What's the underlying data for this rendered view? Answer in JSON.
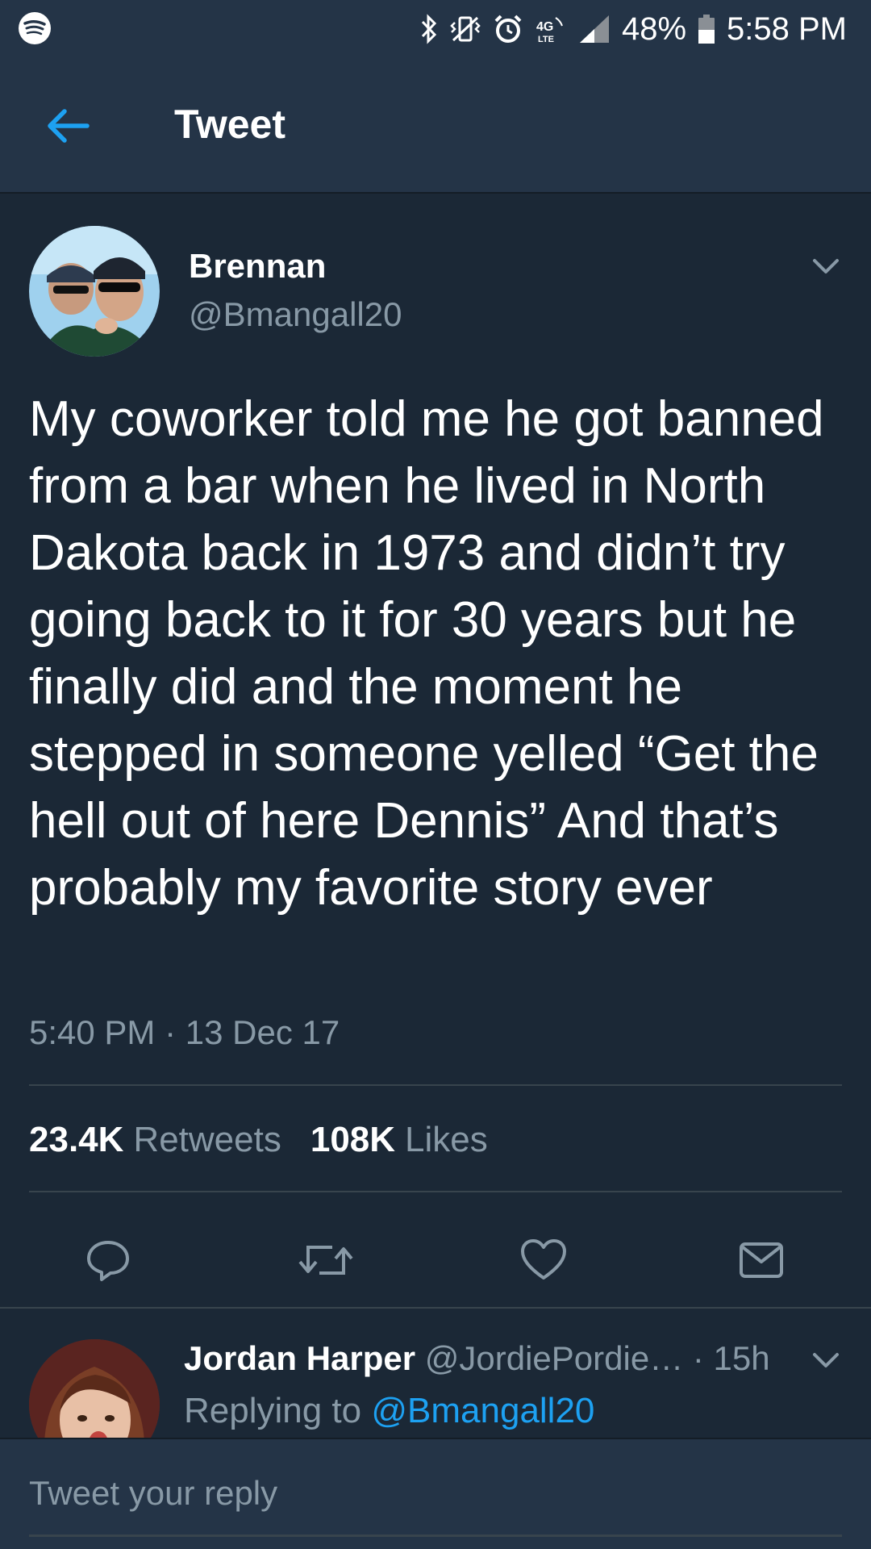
{
  "status_bar": {
    "battery": "48%",
    "time": "5:58 PM",
    "icons": [
      "spotify-icon",
      "bluetooth-icon",
      "vibrate-icon",
      "alarm-icon",
      "4g-lte-icon",
      "signal-icon",
      "battery-icon"
    ]
  },
  "header": {
    "title": "Tweet",
    "back_icon": "arrow-left-icon"
  },
  "tweet": {
    "author_name": "Brennan",
    "author_handle": "@Bmangall20",
    "text": "My coworker told me he got banned from a bar when he lived in North Dakota back in 1973 and didn’t try going back to it for 30 years but he finally did and the moment he stepped in someone yelled “Get the hell out of here Dennis” And that’s probably my favorite story ever",
    "timestamp": "5:40 PM · 13 Dec 17",
    "retweets_count": "23.4K",
    "retweets_label": "Retweets",
    "likes_count": "108K",
    "likes_label": "Likes",
    "actions": [
      "reply-icon",
      "retweet-icon",
      "like-icon",
      "message-icon"
    ]
  },
  "reply": {
    "name": "Jordan Harper",
    "handle": "@JordiePordie…",
    "time": " · 15h",
    "replying_prefix": "Replying to ",
    "replying_handle": "@Bmangall20"
  },
  "compose": {
    "placeholder": "Tweet your reply"
  },
  "colors": {
    "background": "#1b2836",
    "bar": "#243447",
    "accent": "#1da1f2",
    "muted": "#8899a6",
    "divider": "#38444d"
  }
}
